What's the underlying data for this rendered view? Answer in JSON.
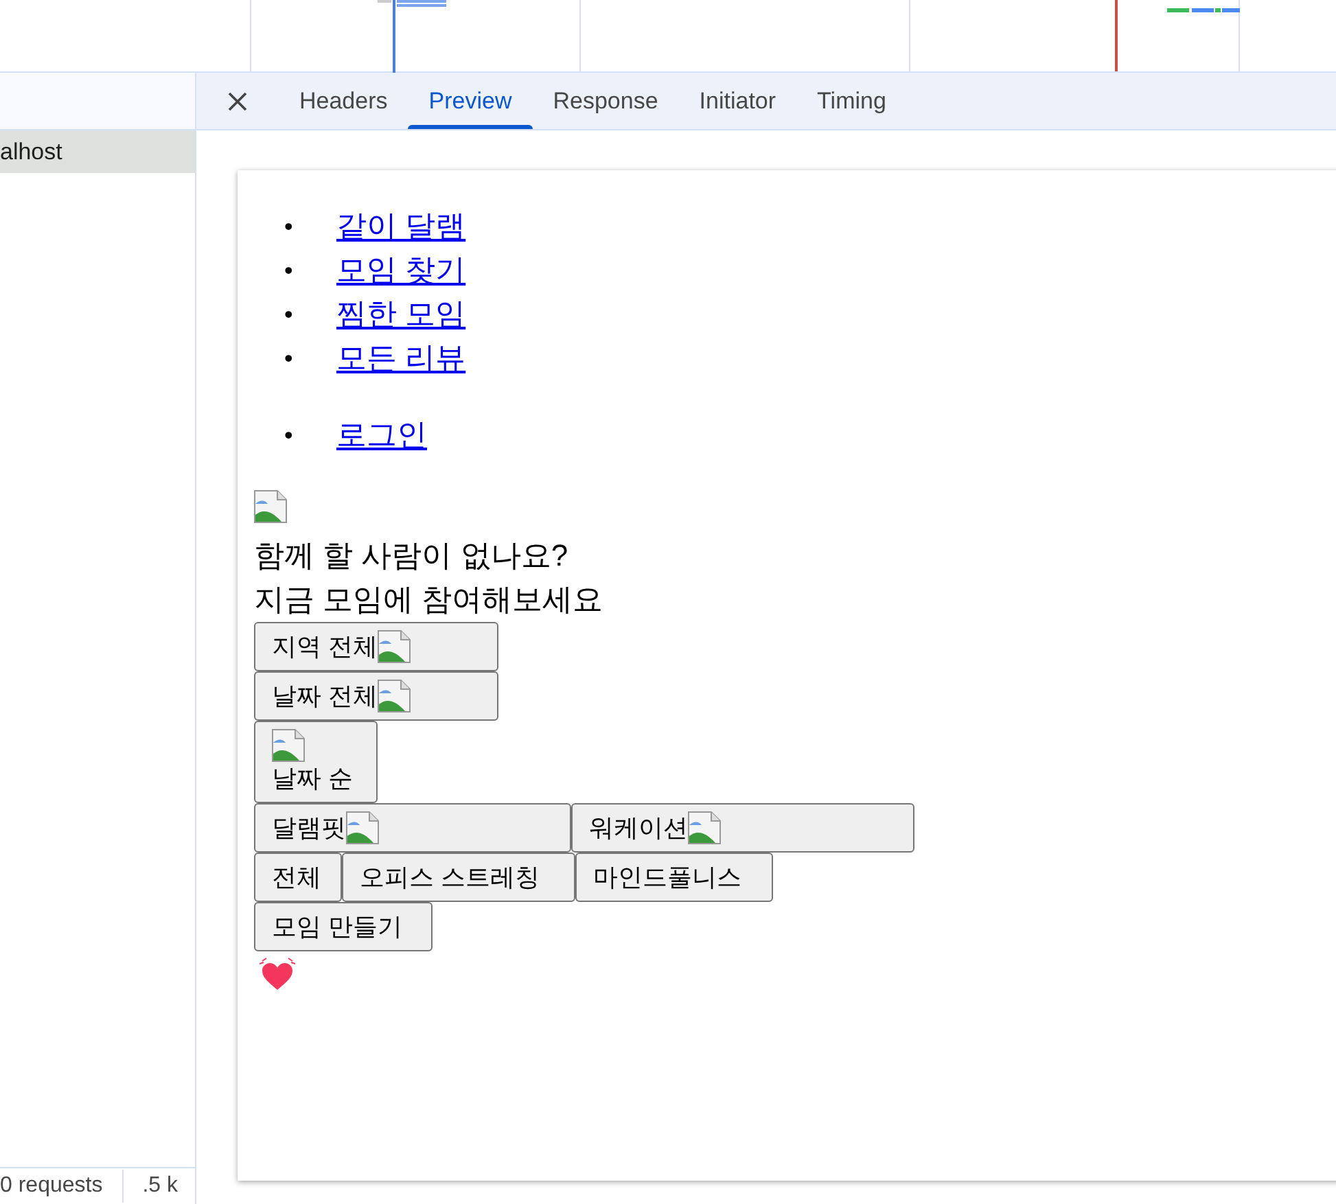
{
  "request_list": {
    "items": [
      {
        "label": "alhost",
        "selected": true
      }
    ]
  },
  "status_bar": [
    "0 requests",
    ".5 k"
  ],
  "tabs": [
    {
      "label": "Headers",
      "selected": false
    },
    {
      "label": "Preview",
      "selected": true
    },
    {
      "label": "Response",
      "selected": false
    },
    {
      "label": "Initiator",
      "selected": false
    },
    {
      "label": "Timing",
      "selected": false
    }
  ],
  "preview": {
    "nav_links": [
      {
        "marker": "•",
        "label": "같이 달램"
      },
      {
        "marker": "•",
        "label": "모임 찾기"
      },
      {
        "marker": "•",
        "label": "찜한 모임"
      },
      {
        "marker": "•",
        "label": "모든 리뷰"
      }
    ],
    "auth_links": [
      {
        "marker": "•",
        "label": "로그인"
      }
    ],
    "headline": [
      "함께 할 사람이 없나요?",
      "지금 모임에 참여해보세요"
    ],
    "button_rows": [
      [
        {
          "label": "지역 전체",
          "kind": "text_image"
        }
      ],
      [
        {
          "label": "날짜 전체",
          "kind": "text_image"
        }
      ],
      [
        {
          "label": "날짜 순",
          "kind": "image_text"
        }
      ],
      [
        {
          "label": "달램핏",
          "kind": "text_image"
        },
        {
          "label": "워케이션",
          "kind": "text_image"
        }
      ],
      [
        {
          "label": "전체",
          "kind": "text"
        },
        {
          "label": "오피스 스트레칭",
          "kind": "text"
        },
        {
          "label": "마인드풀니스",
          "kind": "text"
        }
      ],
      [
        {
          "label": "모임 만들기",
          "kind": "text"
        }
      ]
    ]
  }
}
